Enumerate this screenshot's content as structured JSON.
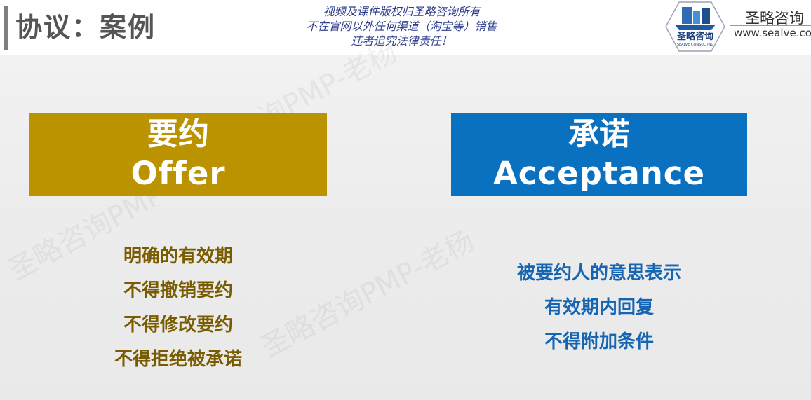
{
  "slide": {
    "title": "协议：案例",
    "copyright_lines": [
      "视频及课件版权归圣略咨询所有",
      "不在官网以外任何渠道（淘宝等）销售",
      "违者追究法律责任！"
    ],
    "logo": {
      "badge_text": "圣略咨询",
      "badge_subtext": "SEALVE CONSULTING",
      "company_name": "圣略咨询",
      "url": "www.sealve.co"
    },
    "watermark": "圣略咨询PMP-老杨"
  },
  "offer": {
    "title_cn": "要约",
    "title_en": "Offer",
    "color": "#bb9200",
    "points": [
      "明确的有效期",
      "不得撤销要约",
      "不得修改要约",
      "不得拒绝被承诺"
    ]
  },
  "acceptance": {
    "title_cn": "承诺",
    "title_en": "Acceptance",
    "color": "#0a70c0",
    "points": [
      "被要约人的意思表示",
      "有效期内回复",
      "不得附加条件"
    ]
  }
}
